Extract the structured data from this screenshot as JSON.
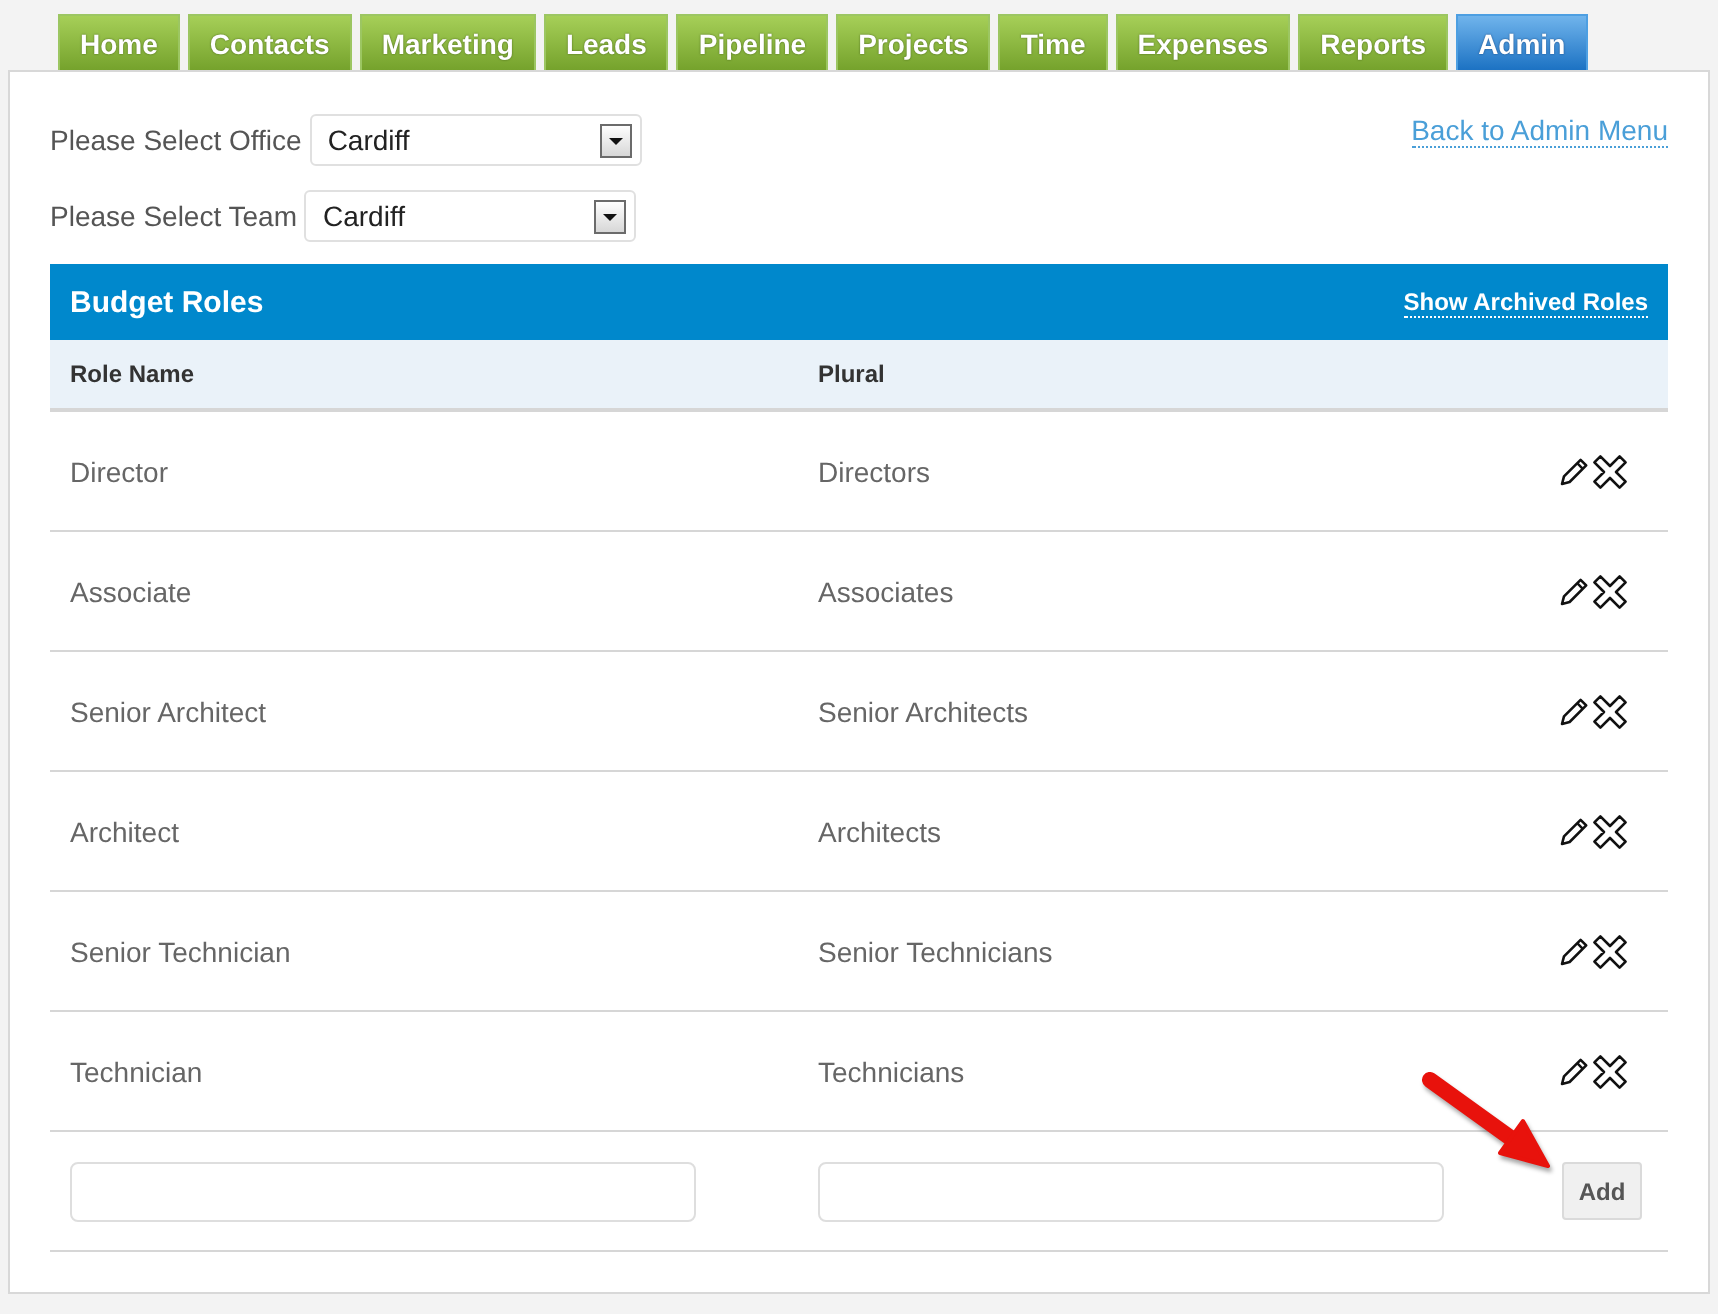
{
  "nav_tabs": [
    {
      "label": "Home",
      "selected": false
    },
    {
      "label": "Contacts",
      "selected": false
    },
    {
      "label": "Marketing",
      "selected": false
    },
    {
      "label": "Leads",
      "selected": false
    },
    {
      "label": "Pipeline",
      "selected": false
    },
    {
      "label": "Projects",
      "selected": false
    },
    {
      "label": "Time",
      "selected": false
    },
    {
      "label": "Expenses",
      "selected": false
    },
    {
      "label": "Reports",
      "selected": false
    },
    {
      "label": "Admin",
      "selected": true
    }
  ],
  "filters": [
    {
      "label": "Please Select Office",
      "value": "Cardiff"
    },
    {
      "label": "Please Select Team",
      "value": "Cardiff"
    }
  ],
  "back_link": "Back to Admin Menu",
  "panel": {
    "title": "Budget Roles",
    "action_link": "Show Archived Roles"
  },
  "table": {
    "columns": [
      "Role Name",
      "Plural"
    ],
    "rows": [
      {
        "role_name": "Director",
        "plural": "Directors"
      },
      {
        "role_name": "Associate",
        "plural": "Associates"
      },
      {
        "role_name": "Senior Architect",
        "plural": "Senior Architects"
      },
      {
        "role_name": "Architect",
        "plural": "Architects"
      },
      {
        "role_name": "Senior Technician",
        "plural": "Senior Technicians"
      },
      {
        "role_name": "Technician",
        "plural": "Technicians"
      }
    ]
  },
  "new_row": {
    "button": "Add"
  }
}
